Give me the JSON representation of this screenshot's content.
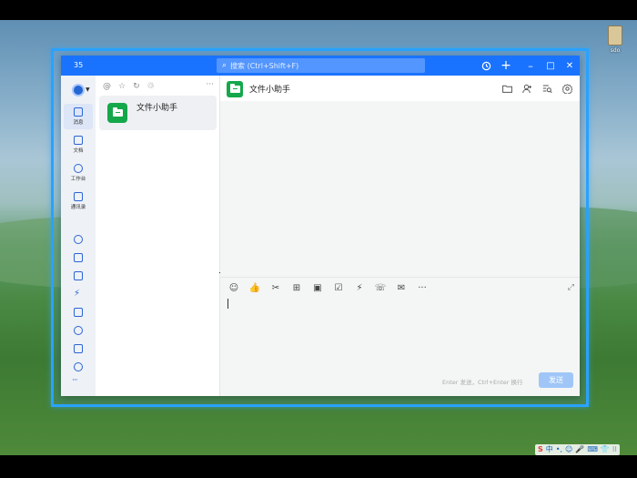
{
  "desktop": {
    "icon_label": "sdo",
    "tray": [
      "S",
      "中",
      "•,",
      "☺",
      "🎤",
      "⌨",
      "👕",
      "⁝⁝"
    ]
  },
  "titlebar": {
    "avatar_text": "35",
    "search_placeholder": "搜索 (Ctrl+Shift+F)",
    "buttons": {
      "history": "history-icon",
      "add": "+",
      "minimize": "–",
      "maximize": "□",
      "close": "✕"
    }
  },
  "sidebar": {
    "items": [
      {
        "label": "消息",
        "icon": "message-icon",
        "active": true
      },
      {
        "label": "文档",
        "icon": "document-icon"
      },
      {
        "label": "工作台",
        "icon": "workbench-icon"
      },
      {
        "label": "通讯录",
        "icon": "contacts-icon"
      }
    ],
    "more": "···"
  },
  "conversations": {
    "tools": [
      "@",
      "☆",
      "↻",
      "♲"
    ],
    "more": "···",
    "items": [
      {
        "name": "文件小助手"
      }
    ]
  },
  "chat": {
    "title": "文件小助手",
    "compose_tools": [
      "☺",
      "👍",
      "✂",
      "⊞",
      "▣",
      "☑",
      "⚡",
      "☏",
      "✉",
      "···"
    ],
    "hint": "Enter 发送，Ctrl+Enter 换行",
    "send_label": "发送"
  },
  "colors": {
    "brand": "#1a73ff",
    "file_helper": "#14a84b",
    "send_disabled": "#9fc6f7"
  }
}
